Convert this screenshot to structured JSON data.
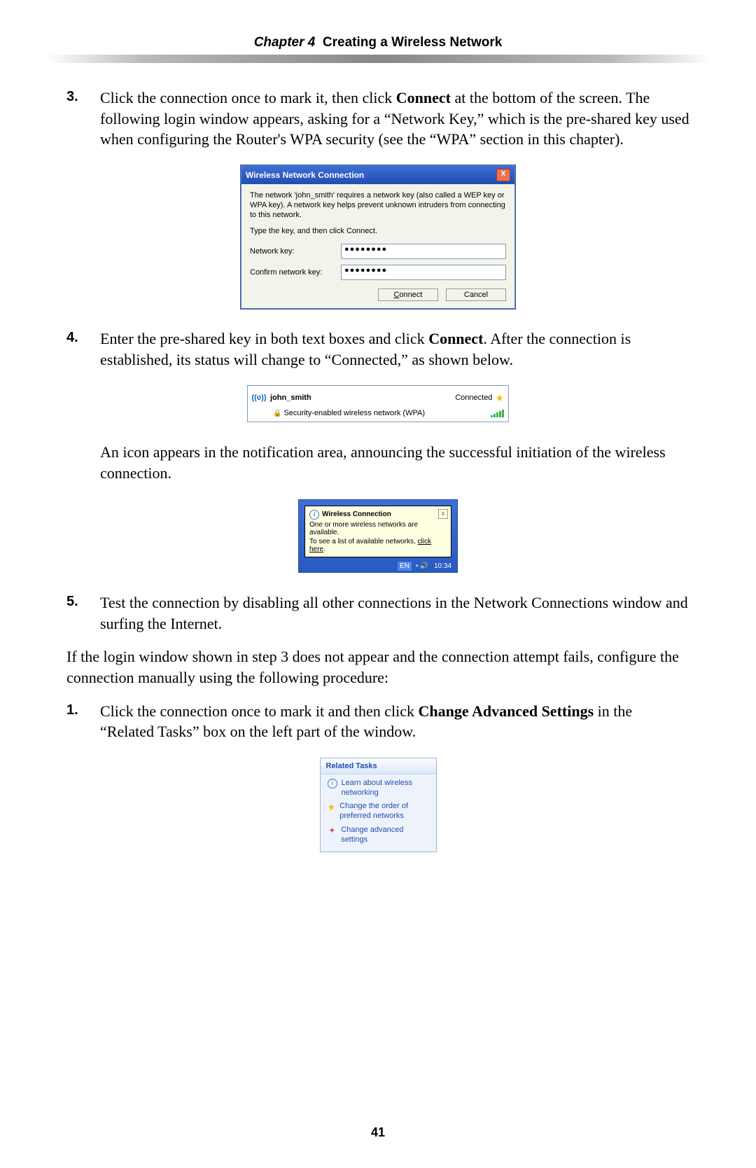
{
  "header": {
    "chapter_label": "Chapter 4",
    "chapter_title": "Creating a Wireless Network"
  },
  "steps_a": [
    {
      "num": "3.",
      "pre": "Click the connection once to mark it, then click ",
      "bold": "Connect",
      "post": " at the bottom of the screen. The following login window appears, asking for a “Network Key,” which is the pre-shared key used when configuring the Router's WPA security (see the  “WPA” section in this chapter)."
    }
  ],
  "dialog1": {
    "title": "Wireless Network Connection",
    "close": "X",
    "desc": "The network 'john_smith' requires a network key (also called a WEP key or WPA key). A network key helps prevent unknown intruders from connecting to this network.",
    "instruction": "Type the key, and then click Connect.",
    "label_key": "Network key:",
    "label_confirm": "Confirm network key:",
    "value_key": "●●●●●●●●",
    "value_confirm": "●●●●●●●●",
    "btn_connect_u": "C",
    "btn_connect_rest": "onnect",
    "btn_cancel": "Cancel"
  },
  "step4": {
    "num": "4.",
    "pre": "Enter the pre-shared key in both text boxes and click ",
    "bold": "Connect",
    "post": ". After the connection is established, its status will change to “Connected,” as shown below."
  },
  "netrow": {
    "ssid": "john_smith",
    "status": "Connected",
    "subtype": "Security-enabled wireless network (WPA)"
  },
  "para_icon": "An icon appears in the notification area, announcing the successful initiation of the wireless connection.",
  "balloon": {
    "title": "Wireless Connection",
    "line1": "One or more wireless networks are available.",
    "line2_pre": "To see a list of available networks, ",
    "line2_link": "click here",
    "line2_post": ".",
    "close": "x",
    "lang": "EN",
    "time": "10:34"
  },
  "step5": {
    "num": "5.",
    "text": "Test the connection by disabling all other connections in the Network Connections window and surfing the Internet."
  },
  "para_fallback": "If the login window shown in step 3 does not appear and the connection attempt fails, configure the connection manually using the following procedure:",
  "step1b": {
    "num": "1.",
    "pre": "Click the connection once to mark it and then click ",
    "bold": "Change Advanced Settings",
    "post": " in the “Related Tasks” box on the left part of the window."
  },
  "tasks": {
    "header": "Related Tasks",
    "items": [
      "Learn about wireless networking",
      "Change the order of preferred networks",
      "Change advanced settings"
    ]
  },
  "page_number": "41"
}
